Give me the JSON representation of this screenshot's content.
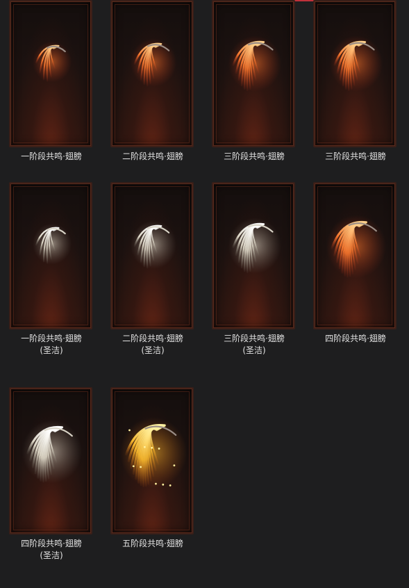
{
  "items": [
    {
      "title": "一阶段共鸣·翅膀",
      "subtitle": "",
      "stage": 1,
      "palette": "fire"
    },
    {
      "title": "二阶段共鸣·翅膀",
      "subtitle": "",
      "stage": 2,
      "palette": "fire"
    },
    {
      "title": "三阶段共鸣·翅膀",
      "subtitle": "",
      "stage": 3,
      "palette": "fire"
    },
    {
      "title": "三阶段共鸣·翅膀",
      "subtitle": "",
      "stage": 3,
      "palette": "fire"
    },
    {
      "title": "一阶段共鸣·翅膀",
      "subtitle": "(圣洁)",
      "stage": 1,
      "palette": "holy"
    },
    {
      "title": "二阶段共鸣·翅膀",
      "subtitle": "(圣洁)",
      "stage": 2,
      "palette": "holy"
    },
    {
      "title": "三阶段共鸣·翅膀",
      "subtitle": "(圣洁)",
      "stage": 3,
      "palette": "holy"
    },
    {
      "title": "四阶段共鸣·翅膀",
      "subtitle": "",
      "stage": 4,
      "palette": "fire"
    },
    {
      "title": "四阶段共鸣·翅膀",
      "subtitle": "(圣洁)",
      "stage": 4,
      "palette": "holy"
    },
    {
      "title": "五阶段共鸣·翅膀",
      "subtitle": "",
      "stage": 5,
      "palette": "gold"
    }
  ],
  "colors": {
    "page_background": "#1e1e1f",
    "caption_text": "#e2e2e2",
    "accent": "#c0313a",
    "fire": [
      "#ffd08a",
      "#ff7a2e",
      "#c3381a"
    ],
    "holy": [
      "#ffffff",
      "#e6e0cf",
      "#8f8a7c"
    ],
    "gold": [
      "#fff1a0",
      "#ffbe2e",
      "#d86a12"
    ]
  }
}
